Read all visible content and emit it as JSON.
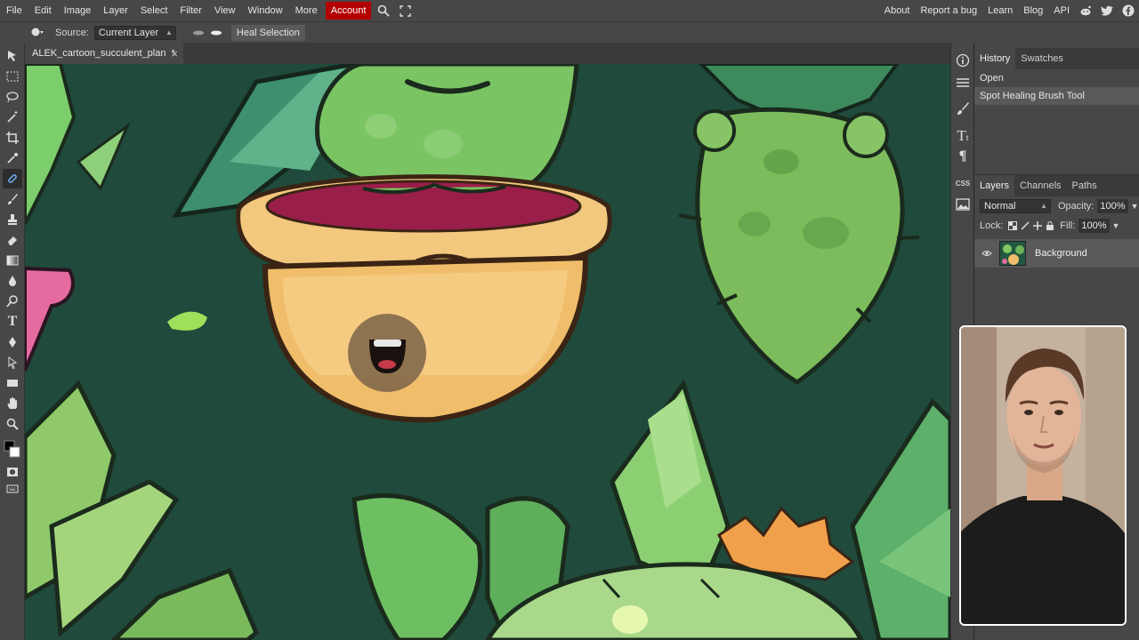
{
  "menu": {
    "items": [
      "File",
      "Edit",
      "Image",
      "Layer",
      "Select",
      "Filter",
      "View",
      "Window",
      "More"
    ],
    "account": "Account",
    "right_items": [
      "About",
      "Report a bug",
      "Learn",
      "Blog",
      "API"
    ]
  },
  "options": {
    "source_label": "Source:",
    "source_value": "Current Layer",
    "heal_selection": "Heal Selection"
  },
  "document": {
    "tab_title": "ALEK_cartoon_succulent_plan",
    "modified_marker": "*"
  },
  "history": {
    "tabs": [
      "History",
      "Swatches"
    ],
    "items": [
      "Open",
      "Spot Healing Brush Tool"
    ]
  },
  "layers": {
    "tabs": [
      "Layers",
      "Channels",
      "Paths"
    ],
    "blend_mode": "Normal",
    "opacity_label": "Opacity:",
    "opacity_value": "100%",
    "lock_label": "Lock:",
    "fill_label": "Fill:",
    "fill_value": "100%",
    "layer_names": [
      "Background"
    ]
  },
  "dock": {
    "css_label": "CSS"
  },
  "colors": {
    "ui_bg": "#474747",
    "account_red": "#b40000",
    "canvas_bg": "#1f4a3c"
  }
}
